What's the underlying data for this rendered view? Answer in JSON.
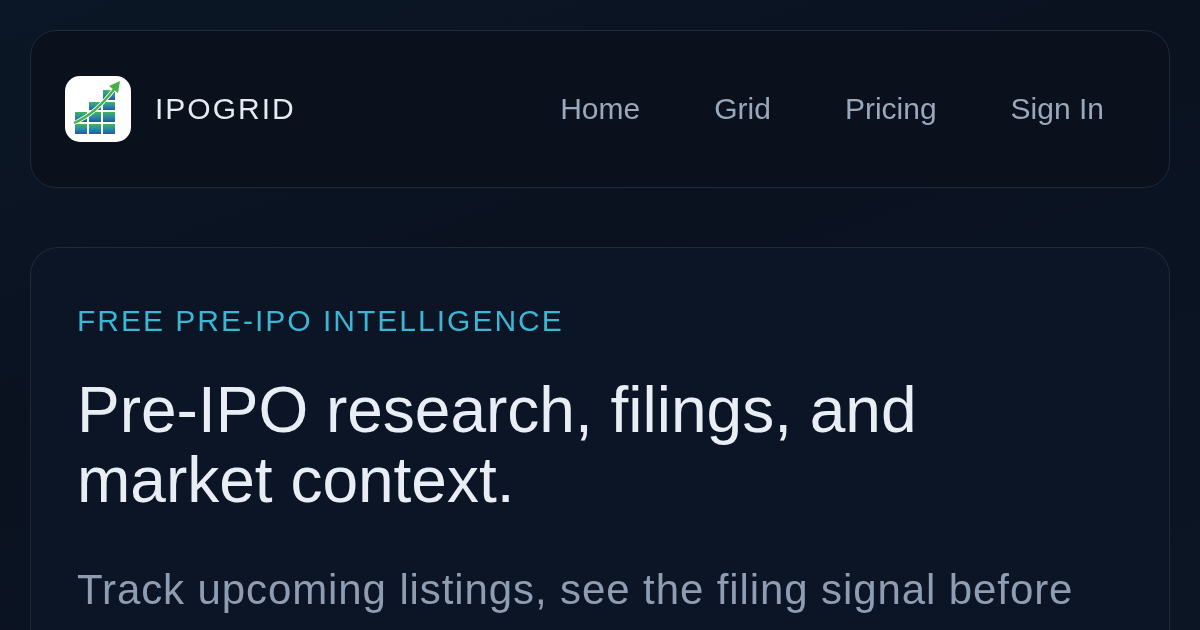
{
  "brand": {
    "name": "IPOGRID"
  },
  "nav": [
    {
      "label": "Home"
    },
    {
      "label": "Grid"
    },
    {
      "label": "Pricing"
    },
    {
      "label": "Sign In"
    }
  ],
  "hero": {
    "eyebrow": "FREE PRE-IPO INTELLIGENCE",
    "heading": "Pre-IPO research, filings, and market context.",
    "description": "Track upcoming listings, see the filing signal before"
  }
}
